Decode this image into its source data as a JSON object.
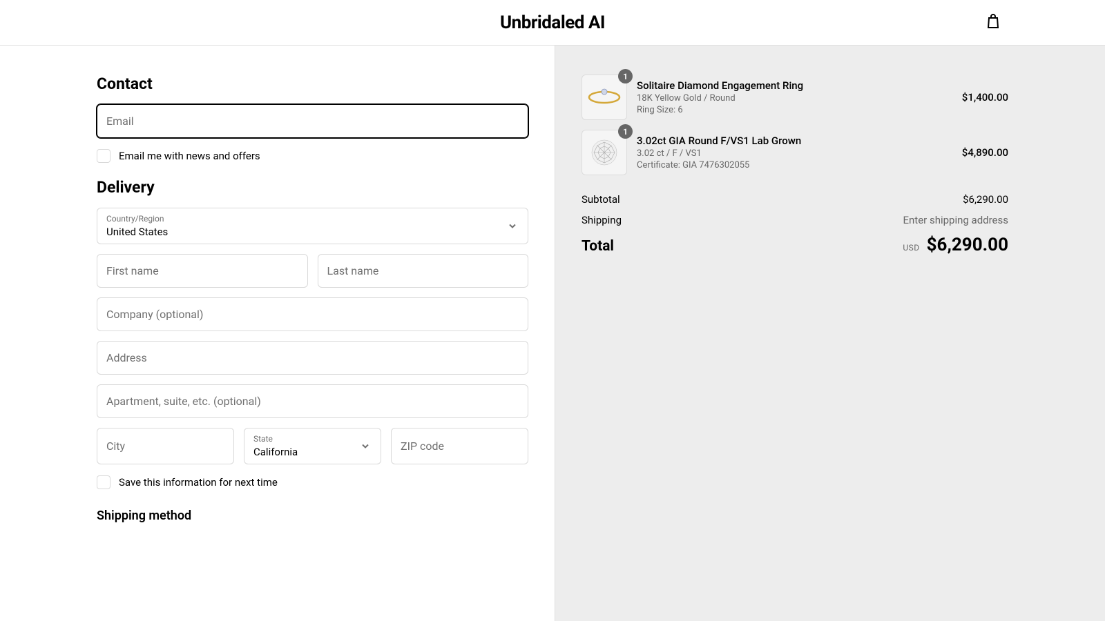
{
  "header": {
    "brand": "Unbridaled AI"
  },
  "contact": {
    "heading": "Contact",
    "email_placeholder": "Email",
    "newsletter_label": "Email me with news and offers"
  },
  "delivery": {
    "heading": "Delivery",
    "country_label": "Country/Region",
    "country_value": "United States",
    "first_name_placeholder": "First name",
    "last_name_placeholder": "Last name",
    "company_placeholder": "Company (optional)",
    "address_placeholder": "Address",
    "apartment_placeholder": "Apartment, suite, etc. (optional)",
    "city_placeholder": "City",
    "state_label": "State",
    "state_value": "California",
    "zip_placeholder": "ZIP code",
    "save_info_label": "Save this information for next time"
  },
  "shipping_method": {
    "heading": "Shipping method"
  },
  "cart": {
    "items": [
      {
        "qty": "1",
        "title": "Solitaire Diamond Engagement Ring",
        "meta1": "18K Yellow Gold / Round",
        "meta2": "Ring Size: 6",
        "price": "$1,400.00"
      },
      {
        "qty": "1",
        "title": "3.02ct GIA Round F/VS1 Lab Grown",
        "meta1": "3.02 ct / F / VS1",
        "meta2": "Certificate: GIA 7476302055",
        "price": "$4,890.00"
      }
    ],
    "subtotal_label": "Subtotal",
    "subtotal_value": "$6,290.00",
    "shipping_label": "Shipping",
    "shipping_value": "Enter shipping address",
    "total_label": "Total",
    "currency_code": "USD",
    "total_value": "$6,290.00"
  }
}
